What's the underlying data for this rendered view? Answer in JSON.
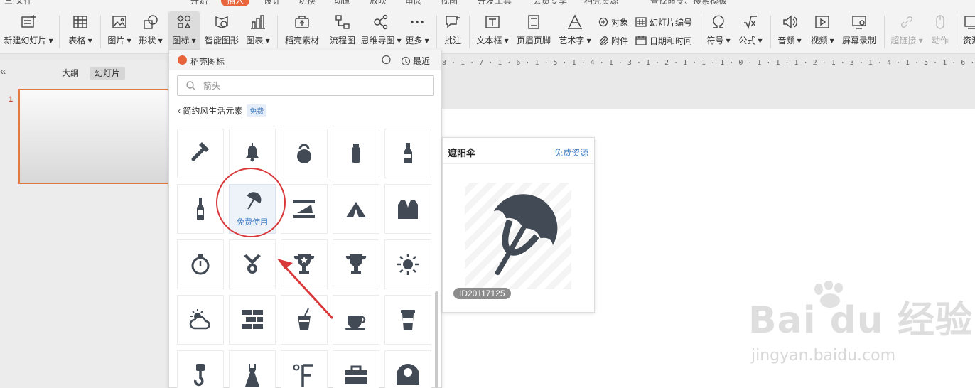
{
  "menu": {
    "items": [
      "三 文件",
      "开始",
      "插入",
      "设计",
      "切换",
      "动画",
      "放映",
      "审阅",
      "视图",
      "开发工具",
      "会员专享",
      "稻壳资源",
      "查找命令、搜索模板"
    ],
    "active_index": 2
  },
  "ribbon": {
    "new_slide": "新建幻灯片",
    "table": "表格",
    "image": "图片",
    "shape": "形状",
    "icon": "图标",
    "smart_art": "智能图形",
    "chart": "图表",
    "docer_material": "稻壳素材",
    "flowchart": "流程图",
    "mindmap": "思维导图",
    "more": "更多",
    "comment": "批注",
    "textbox": "文本框",
    "header_footer": "页眉页脚",
    "wordart": "艺术字",
    "object": "对象",
    "attachment": "附件",
    "slide_number": "幻灯片编号",
    "datetime": "日期和时间",
    "symbol": "符号",
    "formula": "公式",
    "audio": "音频",
    "video": "视频",
    "screen_record": "屏幕录制",
    "hyperlink": "超链接",
    "action": "动作",
    "resource": "资源"
  },
  "ruler_text": "8 · 1 · 7 · 1 · 6 · 1 · 5 · 1 · 4 · 1 · 3 · 1 · 2 · 1 · 1 · 1 · 0 · 1 · 1 · 1 · 2 · 1 · 3 · 1 · 4 · 1 · 5 · 1 · 6 · 1 · 7 · 1 · 8 · 1 · 9 · 1 · 10 · 1 · 11 ·",
  "left_panel": {
    "tabs": [
      "大纲",
      "幻灯片"
    ],
    "active_tab": 1,
    "slide_number": "1"
  },
  "icon_panel": {
    "title": "稻壳图标",
    "recent": "最近",
    "search_placeholder": "箭头",
    "breadcrumb": "简约风生活元素",
    "breadcrumb_badge": "免费",
    "hover_label": "免费使用",
    "icons": [
      [
        "hammer-icon",
        "bell-icon",
        "kettlebell-icon",
        "water-bottle-icon",
        "beer-bottle-icon"
      ],
      [
        "wine-bottle-icon",
        "umbrella-icon",
        "ruler-zigzag-icon",
        "tent-icon",
        "suit-icon"
      ],
      [
        "stopwatch-icon",
        "medal-icon",
        "trophy-star-icon",
        "trophy-icon",
        "sun-icon"
      ],
      [
        "sun-cloud-icon",
        "bricks-icon",
        "drink-cup-icon",
        "coffee-cup-icon",
        "takeaway-cup-icon"
      ],
      [
        "hook-icon",
        "dress-icon",
        "fahrenheit-icon",
        "toolbox-icon",
        "bib-icon"
      ]
    ]
  },
  "preview": {
    "title": "遮阳伞",
    "link": "免费资源",
    "id_label": "ID20117125"
  },
  "watermark": {
    "brand": "Bai du 经验",
    "url": "jingyan.baidu.com"
  },
  "colors": {
    "accent": "#e8643a",
    "annotation": "#d9383a",
    "link": "#3c7cc2",
    "icon_fill": "#424a55"
  }
}
